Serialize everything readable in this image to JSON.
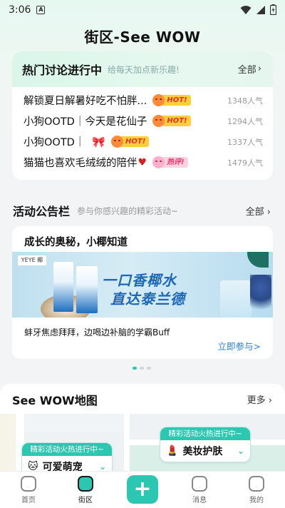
{
  "status": {
    "time": "3:06",
    "notif_icon": "A"
  },
  "page_title": "街区-See WOW",
  "hot": {
    "title": "热门讨论进行中",
    "subtitle": "给每天加点新乐趣!",
    "all_label": "全部",
    "items": [
      {
        "text": "解锁夏日解暑好吃不怕胖...",
        "badge": "HOT!",
        "count": "1348人气"
      },
      {
        "text": "小狗OOTD｜今天是花仙子",
        "badge": "HOT!",
        "count": "1294人气"
      },
      {
        "text": "小狗OOTD｜",
        "badge": "HOT!",
        "count": "1337人气"
      },
      {
        "text": "猫猫也喜欢毛绒绒的陪伴",
        "badge": "热评!",
        "count": "1479人气"
      }
    ]
  },
  "activity": {
    "title": "活动公告栏",
    "subtitle": "参与你感兴趣的精彩活动~",
    "all_label": "全部",
    "card_title": "成长的奥秘，小椰知道",
    "banner_line1": "一口香椰水",
    "banner_line2": "直达泰兰德",
    "banner_logo": "YEYE 椰",
    "description": "蚌牙焦虑拜拜，边喝边补脑的学霸Buff",
    "link": "立即参与>"
  },
  "map": {
    "title": "See WOW地图",
    "more_label": "更多",
    "pins": [
      {
        "head": "精彩活动火热进行中~",
        "label": "可爱萌宠"
      },
      {
        "head": "精彩活动火热进行中~",
        "label": "美妆护肤"
      }
    ]
  },
  "tabs": [
    {
      "label": "首页"
    },
    {
      "label": "街区"
    },
    {
      "label": "消息"
    },
    {
      "label": "我的"
    }
  ],
  "colors": {
    "accent": "#2cc7b0",
    "link": "#2a7ec7",
    "hot_tag": "#ffcf3a"
  }
}
